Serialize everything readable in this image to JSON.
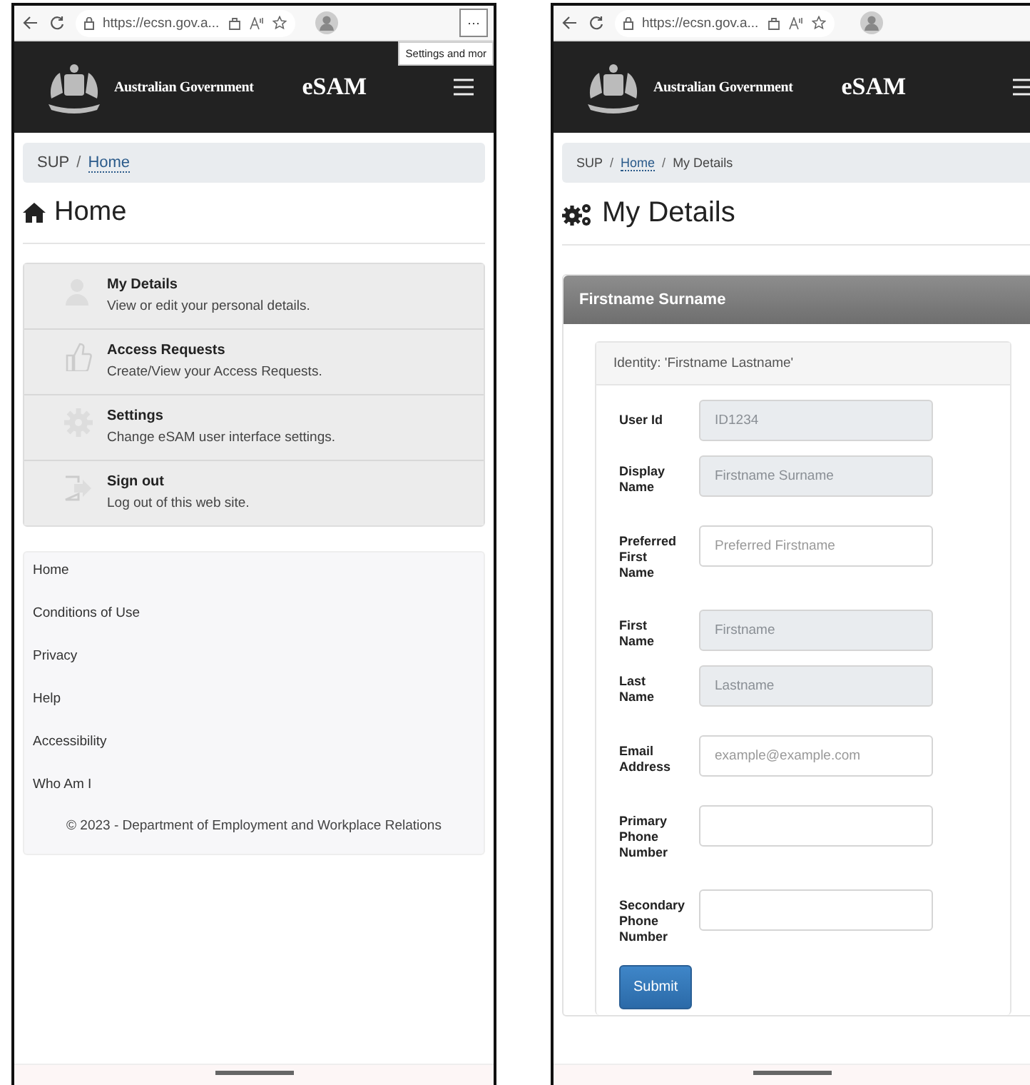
{
  "home_screen": {
    "browser": {
      "url": "https://ecsn.gov.a...",
      "more": "···",
      "tooltip": "Settings and mor"
    },
    "header": {
      "agency": "Australian Government",
      "app_name": "eSAM"
    },
    "breadcrumb": [
      {
        "label": "SUP",
        "link": false
      },
      {
        "separator": "/",
        "label": "Home",
        "link": true
      }
    ],
    "title": "Home",
    "menu": [
      {
        "kind": "person",
        "title": "My Details",
        "description": "View or edit your personal details."
      },
      {
        "kind": "thumb",
        "title": "Access Requests",
        "description": "Create/View your Access Requests."
      },
      {
        "kind": "gear",
        "title": "Settings",
        "description": "Change eSAM user interface settings."
      },
      {
        "kind": "signout",
        "title": "Sign out",
        "description": "Log out of this web site."
      }
    ],
    "footer_links": [
      "Home",
      "Conditions of Use",
      "Privacy",
      "Help",
      "Accessibility",
      "Who Am I"
    ],
    "copyright": "© 2023 - Department of Employment and Workplace Relations"
  },
  "details_screen": {
    "browser": {
      "url": "https://ecsn.gov.a..."
    },
    "header": {
      "agency": "Australian Government",
      "app_name": "eSAM"
    },
    "breadcrumb": [
      {
        "label": "SUP",
        "link": false
      },
      {
        "separator": "/",
        "label": "Home",
        "link": true
      },
      {
        "separator": "/",
        "label": "My Details",
        "link": false
      }
    ],
    "title": "My Details",
    "panel_title": "Firstname Surname",
    "identity": "Identity: 'Firstname Lastname'",
    "fields": [
      {
        "label": "User Id",
        "value": "ID1234",
        "disabled": true
      },
      {
        "label": "Display Name",
        "value": "Firstname Surname",
        "disabled": true
      },
      {
        "label": "Preferred First Name",
        "placeholder": "Preferred Firstname",
        "disabled": false
      },
      {
        "label": "First Name",
        "value": "Firstname",
        "disabled": true
      },
      {
        "label": "Last Name",
        "value": "Lastname",
        "disabled": true
      },
      {
        "label": "Email Address",
        "placeholder": "example@example.com",
        "disabled": false
      },
      {
        "label": "Primary Phone Number",
        "disabled": false
      },
      {
        "label": "Secondary Phone Number",
        "disabled": false
      }
    ],
    "submit": "Submit"
  }
}
